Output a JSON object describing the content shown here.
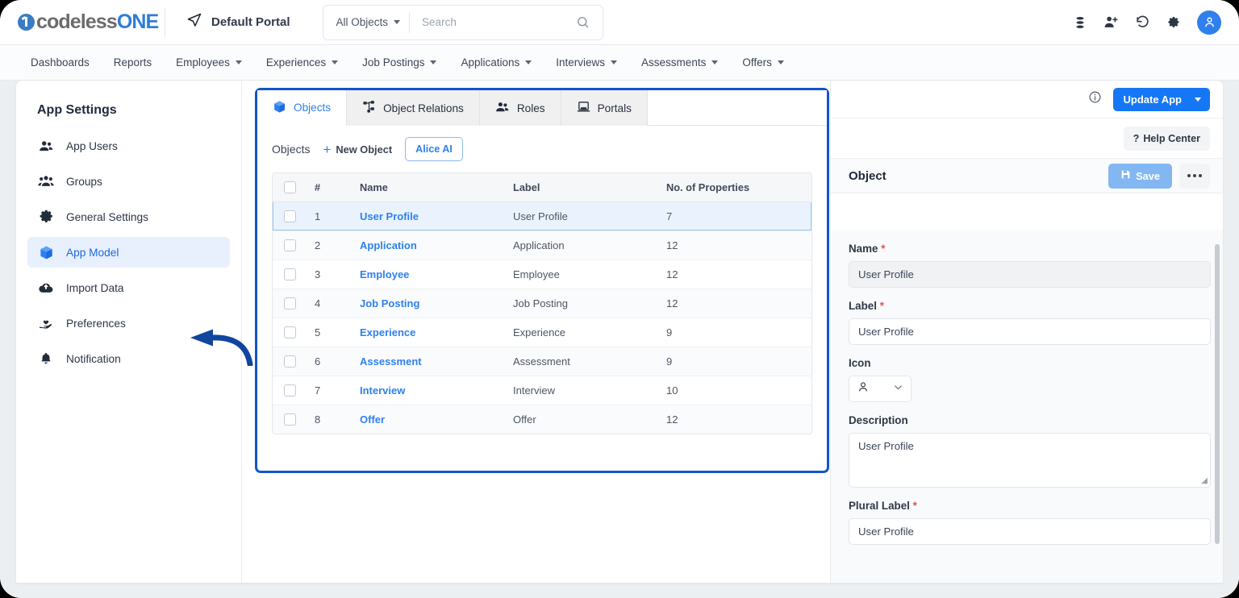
{
  "header": {
    "logo_gray": "codeless",
    "logo_blue": "ONE",
    "portal_label": "Default Portal",
    "search": {
      "scope": "All Objects",
      "placeholder": "Search",
      "value": ""
    },
    "icons": [
      "database-icon",
      "add-user-icon",
      "history-icon",
      "gear-icon",
      "avatar"
    ]
  },
  "nav": {
    "items": [
      {
        "label": "Dashboards",
        "caret": false
      },
      {
        "label": "Reports",
        "caret": false
      },
      {
        "label": "Employees",
        "caret": true
      },
      {
        "label": "Experiences",
        "caret": true
      },
      {
        "label": "Job Postings",
        "caret": true
      },
      {
        "label": "Applications",
        "caret": true
      },
      {
        "label": "Interviews",
        "caret": true
      },
      {
        "label": "Assessments",
        "caret": true
      },
      {
        "label": "Offers",
        "caret": true
      }
    ]
  },
  "sidebar": {
    "title": "App Settings",
    "items": [
      {
        "label": "App Users",
        "icon": "users-icon",
        "active": false
      },
      {
        "label": "Groups",
        "icon": "group-icon",
        "active": false
      },
      {
        "label": "General Settings",
        "icon": "gear-icon",
        "active": false
      },
      {
        "label": "App Model",
        "icon": "cube-icon",
        "active": true
      },
      {
        "label": "Import Data",
        "icon": "cloud-upload-icon",
        "active": false
      },
      {
        "label": "Preferences",
        "icon": "hand-heart-icon",
        "active": false
      },
      {
        "label": "Notification",
        "icon": "bell-icon",
        "active": false
      }
    ]
  },
  "main": {
    "tabs": [
      {
        "label": "Objects",
        "icon": "cube-icon",
        "active": true
      },
      {
        "label": "Object Relations",
        "icon": "relations-icon",
        "active": false
      },
      {
        "label": "Roles",
        "icon": "users-icon",
        "active": false
      },
      {
        "label": "Portals",
        "icon": "portal-icon",
        "active": false
      }
    ],
    "toolbar": {
      "title": "Objects",
      "new_object_label": "New Object",
      "plus": "+",
      "alice_label": "Alice AI"
    },
    "table": {
      "columns": [
        "#",
        "Name",
        "Label",
        "No. of Properties"
      ],
      "rows": [
        {
          "num": "1",
          "name": "User Profile",
          "label": "User Profile",
          "props": "7",
          "selected": true
        },
        {
          "num": "2",
          "name": "Application",
          "label": "Application",
          "props": "12",
          "selected": false
        },
        {
          "num": "3",
          "name": "Employee",
          "label": "Employee",
          "props": "12",
          "selected": false
        },
        {
          "num": "4",
          "name": "Job Posting",
          "label": "Job Posting",
          "props": "12",
          "selected": false
        },
        {
          "num": "5",
          "name": "Experience",
          "label": "Experience",
          "props": "9",
          "selected": false
        },
        {
          "num": "6",
          "name": "Assessment",
          "label": "Assessment",
          "props": "9",
          "selected": false
        },
        {
          "num": "7",
          "name": "Interview",
          "label": "Interview",
          "props": "10",
          "selected": false
        },
        {
          "num": "8",
          "name": "Offer",
          "label": "Offer",
          "props": "12",
          "selected": false
        }
      ]
    }
  },
  "right_panel": {
    "update_app_label": "Update App",
    "help_center_label": "Help Center",
    "help_center_glyph": "?",
    "panel_title": "Object",
    "save_label": "Save",
    "fields": {
      "name_label": "Name",
      "name_value": "User Profile",
      "label_label": "Label",
      "label_value": "User Profile",
      "icon_label": "Icon",
      "icon_value": "person-icon",
      "description_label": "Description",
      "description_value": "User Profile",
      "plural_label_label": "Plural Label",
      "plural_label_value": "User Profile"
    }
  },
  "colors": {
    "accent": "#2f80ed",
    "primary_button": "#1677f5",
    "highlight_border": "#1155cc",
    "selected_row": "#eaf3fd",
    "required": "#e8534a",
    "annotation_arrow": "#11459e"
  }
}
